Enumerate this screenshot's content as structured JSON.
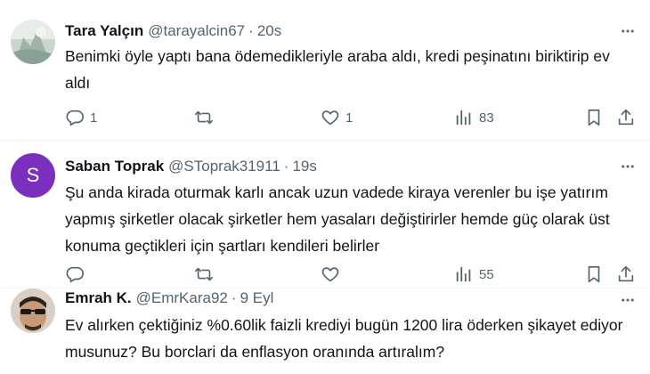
{
  "tweets": [
    {
      "name": "Tara Yalçın",
      "handle": "@tarayalcin67",
      "separator": "·",
      "time": "20s",
      "text": "Benimki öyle yaptı bana ödemedikleriyle araba aldı, kredi peşinatını biriktirip ev aldı",
      "replies": "1",
      "retweets": "",
      "likes": "1",
      "views": "83",
      "avatar_icon": "photo-avatar"
    },
    {
      "name": "Saban Toprak",
      "handle": "@SToprak31911",
      "separator": "·",
      "time": "19s",
      "text": "Şu anda kirada oturmak karlı ancak uzun vadede kiraya verenler bu işe yatırım yapmış şirketler olacak şirketler hem yasaları değiştirirler hemde güç olarak üst konuma geçtikleri için şartları kendileri belirler",
      "replies": "",
      "retweets": "",
      "likes": "",
      "views": "55",
      "avatar_letter": "S",
      "avatar_color": "#7b2fbe"
    },
    {
      "name": "Emrah K.",
      "handle": "@EmrKara92",
      "separator": "·",
      "time": "9 Eyl",
      "text": "Ev alırken çektiğiniz %0.60lik faizli krediyi bugün 1200 lira öderken şikayet ediyor musunuz? Bu borclari da enflasyon oranında artıralım?",
      "avatar_icon": "photo-avatar"
    }
  ],
  "colors": {
    "text": "#0f1419",
    "secondary": "#536471",
    "divider": "#eff3f4"
  }
}
